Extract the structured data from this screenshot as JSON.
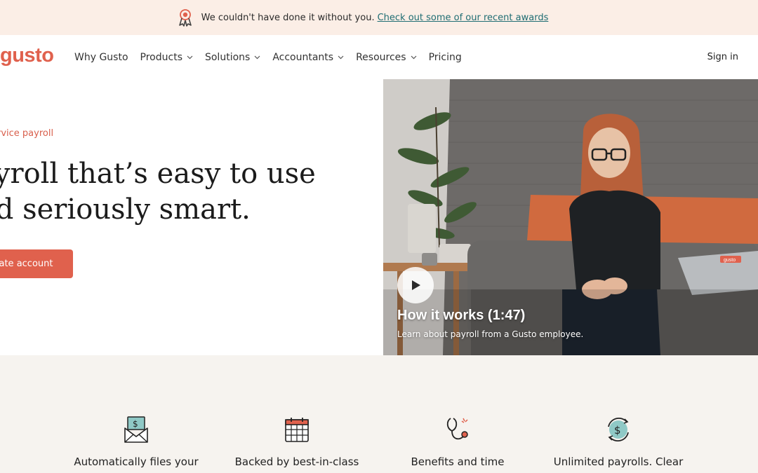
{
  "banner": {
    "message": "We couldn't have done it without you.",
    "link_text": "Check out some of our recent awards",
    "icon": "award-ribbon-icon"
  },
  "nav": {
    "logo_text": "gusto",
    "items": [
      {
        "label": "Why Gusto",
        "has_dropdown": false
      },
      {
        "label": "Products",
        "has_dropdown": true
      },
      {
        "label": "Solutions",
        "has_dropdown": true
      },
      {
        "label": "Accountants",
        "has_dropdown": true
      },
      {
        "label": "Resources",
        "has_dropdown": true
      },
      {
        "label": "Pricing",
        "has_dropdown": false
      }
    ],
    "sign_in": "Sign in"
  },
  "hero": {
    "eyebrow": "ervice payroll",
    "headline_line1": "ayroll that’s easy to use",
    "headline_line2": "nd seriously smart.",
    "cta_label": "eate account"
  },
  "video": {
    "title": "How it works (1:47)",
    "subtitle": "Learn about payroll from a Gusto employee.",
    "laptop_label": "gusto"
  },
  "features": [
    {
      "icon": "envelope-dollar-icon",
      "text": "Automatically files your"
    },
    {
      "icon": "calendar-icon",
      "text": "Backed by best-in-class"
    },
    {
      "icon": "stethoscope-icon",
      "text": "Benefits and time"
    },
    {
      "icon": "dollar-cycle-icon",
      "text": "Unlimited payrolls. Clear"
    }
  ],
  "colors": {
    "brand": "#e0614d",
    "banner_bg": "#fbeee6",
    "link": "#1f6d73",
    "features_bg": "#f6f3ef"
  }
}
